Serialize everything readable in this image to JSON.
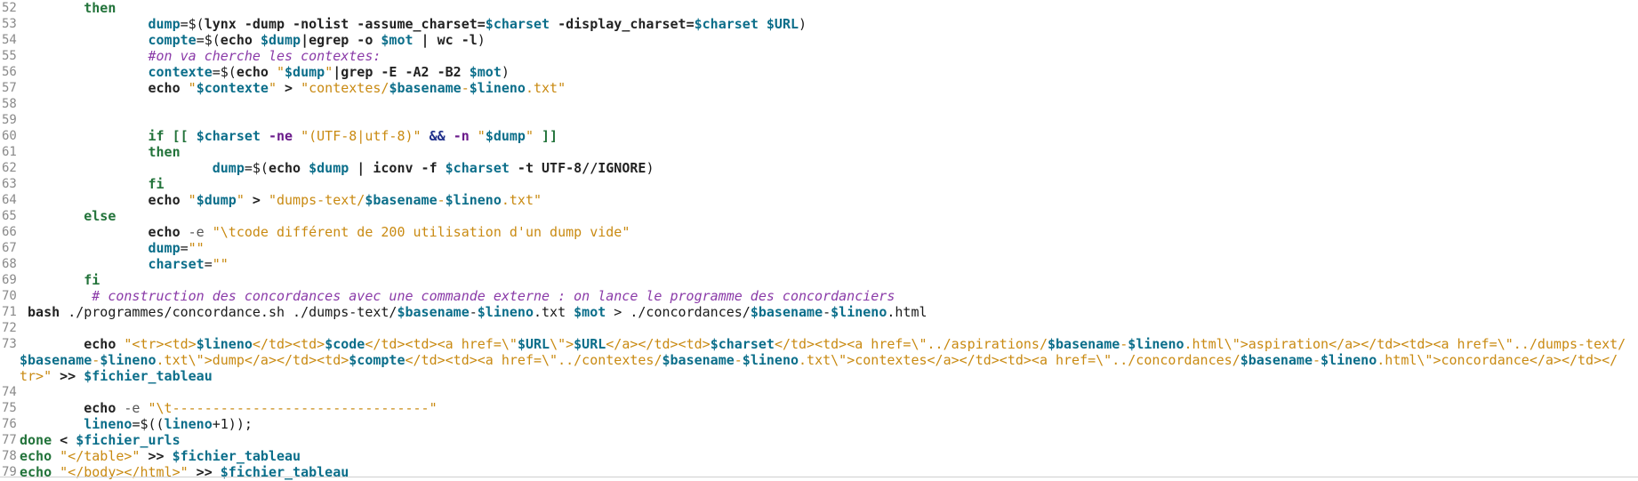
{
  "editor": {
    "lines": [
      {
        "n": "52",
        "tokens": [
          {
            "t": "        ",
            "c": "plain"
          },
          {
            "t": "then",
            "c": "kw"
          }
        ]
      },
      {
        "n": "53",
        "tokens": [
          {
            "t": "                ",
            "c": "plain"
          },
          {
            "t": "dump",
            "c": "var"
          },
          {
            "t": "=$(",
            "c": "plain"
          },
          {
            "t": "lynx -dump -nolist -assume_charset=",
            "c": "cmd"
          },
          {
            "t": "$charset",
            "c": "var"
          },
          {
            "t": " -display_charset=",
            "c": "cmd"
          },
          {
            "t": "$charset",
            "c": "var"
          },
          {
            "t": " ",
            "c": "plain"
          },
          {
            "t": "$URL",
            "c": "var"
          },
          {
            "t": ")",
            "c": "plain"
          }
        ]
      },
      {
        "n": "54",
        "tokens": [
          {
            "t": "                ",
            "c": "plain"
          },
          {
            "t": "compte",
            "c": "var"
          },
          {
            "t": "=$(",
            "c": "plain"
          },
          {
            "t": "echo ",
            "c": "cmd"
          },
          {
            "t": "$dump",
            "c": "var"
          },
          {
            "t": "|egrep -o ",
            "c": "cmd"
          },
          {
            "t": "$mot",
            "c": "var"
          },
          {
            "t": " | wc -l",
            "c": "cmd"
          },
          {
            "t": ")",
            "c": "plain"
          }
        ]
      },
      {
        "n": "55",
        "tokens": [
          {
            "t": "                ",
            "c": "plain"
          },
          {
            "t": "#on va cherche les contextes:",
            "c": "com"
          }
        ]
      },
      {
        "n": "56",
        "tokens": [
          {
            "t": "                ",
            "c": "plain"
          },
          {
            "t": "contexte",
            "c": "var"
          },
          {
            "t": "=$(",
            "c": "plain"
          },
          {
            "t": "echo ",
            "c": "cmd"
          },
          {
            "t": "\"",
            "c": "str"
          },
          {
            "t": "$dump",
            "c": "strvar"
          },
          {
            "t": "\"",
            "c": "str"
          },
          {
            "t": "|grep -E -A2 -B2 ",
            "c": "cmd"
          },
          {
            "t": "$mot",
            "c": "var"
          },
          {
            "t": ")",
            "c": "plain"
          }
        ]
      },
      {
        "n": "57",
        "tokens": [
          {
            "t": "                ",
            "c": "plain"
          },
          {
            "t": "echo ",
            "c": "cmd"
          },
          {
            "t": "\"",
            "c": "str"
          },
          {
            "t": "$contexte",
            "c": "strvar"
          },
          {
            "t": "\"",
            "c": "str"
          },
          {
            "t": " > ",
            "c": "cmd"
          },
          {
            "t": "\"contextes/",
            "c": "str"
          },
          {
            "t": "$basename",
            "c": "strvar"
          },
          {
            "t": "-",
            "c": "str"
          },
          {
            "t": "$lineno",
            "c": "strvar"
          },
          {
            "t": ".txt\"",
            "c": "str"
          }
        ]
      },
      {
        "n": "58",
        "tokens": [
          {
            "t": "",
            "c": "plain"
          }
        ]
      },
      {
        "n": "59",
        "tokens": [
          {
            "t": "",
            "c": "plain"
          }
        ]
      },
      {
        "n": "60",
        "tokens": [
          {
            "t": "                ",
            "c": "plain"
          },
          {
            "t": "if [[ ",
            "c": "kw"
          },
          {
            "t": "$charset",
            "c": "var"
          },
          {
            "t": " -ne ",
            "c": "test"
          },
          {
            "t": "\"(UTF-8|utf-8)\"",
            "c": "str"
          },
          {
            "t": " && ",
            "c": "op"
          },
          {
            "t": "-n ",
            "c": "test"
          },
          {
            "t": "\"",
            "c": "str"
          },
          {
            "t": "$dump",
            "c": "strvar"
          },
          {
            "t": "\"",
            "c": "str"
          },
          {
            "t": " ]]",
            "c": "kw"
          }
        ]
      },
      {
        "n": "61",
        "tokens": [
          {
            "t": "                ",
            "c": "plain"
          },
          {
            "t": "then",
            "c": "kw"
          }
        ]
      },
      {
        "n": "62",
        "tokens": [
          {
            "t": "                        ",
            "c": "plain"
          },
          {
            "t": "dump",
            "c": "var"
          },
          {
            "t": "=$(",
            "c": "plain"
          },
          {
            "t": "echo ",
            "c": "cmd"
          },
          {
            "t": "$dump",
            "c": "var"
          },
          {
            "t": " | iconv -f ",
            "c": "cmd"
          },
          {
            "t": "$charset",
            "c": "var"
          },
          {
            "t": " -t UTF-8//IGNORE",
            "c": "cmd"
          },
          {
            "t": ")",
            "c": "plain"
          }
        ]
      },
      {
        "n": "63",
        "tokens": [
          {
            "t": "                ",
            "c": "plain"
          },
          {
            "t": "fi",
            "c": "kw"
          }
        ]
      },
      {
        "n": "64",
        "tokens": [
          {
            "t": "                ",
            "c": "plain"
          },
          {
            "t": "echo ",
            "c": "cmd"
          },
          {
            "t": "\"",
            "c": "str"
          },
          {
            "t": "$dump",
            "c": "strvar"
          },
          {
            "t": "\"",
            "c": "str"
          },
          {
            "t": " > ",
            "c": "cmd"
          },
          {
            "t": "\"dumps-text/",
            "c": "str"
          },
          {
            "t": "$basename",
            "c": "strvar"
          },
          {
            "t": "-",
            "c": "str"
          },
          {
            "t": "$lineno",
            "c": "strvar"
          },
          {
            "t": ".txt\"",
            "c": "str"
          }
        ]
      },
      {
        "n": "65",
        "tokens": [
          {
            "t": "        ",
            "c": "plain"
          },
          {
            "t": "else",
            "c": "kw"
          }
        ]
      },
      {
        "n": "66",
        "tokens": [
          {
            "t": "                ",
            "c": "plain"
          },
          {
            "t": "echo ",
            "c": "cmd"
          },
          {
            "t": "-e ",
            "c": "dim"
          },
          {
            "t": "\"\\tcode différent de 200 utilisation d'un dump vide\"",
            "c": "str"
          }
        ]
      },
      {
        "n": "67",
        "tokens": [
          {
            "t": "                ",
            "c": "plain"
          },
          {
            "t": "dump",
            "c": "var"
          },
          {
            "t": "=",
            "c": "plain"
          },
          {
            "t": "\"\"",
            "c": "str"
          }
        ]
      },
      {
        "n": "68",
        "tokens": [
          {
            "t": "                ",
            "c": "plain"
          },
          {
            "t": "charset",
            "c": "var"
          },
          {
            "t": "=",
            "c": "plain"
          },
          {
            "t": "\"\"",
            "c": "str"
          }
        ]
      },
      {
        "n": "69",
        "tokens": [
          {
            "t": "        ",
            "c": "plain"
          },
          {
            "t": "fi",
            "c": "kw"
          }
        ]
      },
      {
        "n": "70",
        "tokens": [
          {
            "t": "         ",
            "c": "plain"
          },
          {
            "t": "# construction des concordances avec une commande externe : on lance le programme des concordanciers",
            "c": "com"
          }
        ]
      },
      {
        "n": "71",
        "tokens": [
          {
            "t": " ",
            "c": "plain"
          },
          {
            "t": "bash ",
            "c": "cmd"
          },
          {
            "t": "./programmes/concordance.sh ./dumps-text/",
            "c": "plain"
          },
          {
            "t": "$basename",
            "c": "var"
          },
          {
            "t": "-",
            "c": "plain"
          },
          {
            "t": "$lineno",
            "c": "var"
          },
          {
            "t": ".txt ",
            "c": "plain"
          },
          {
            "t": "$mot",
            "c": "var"
          },
          {
            "t": " > ./concordances/",
            "c": "plain"
          },
          {
            "t": "$basename",
            "c": "var"
          },
          {
            "t": "-",
            "c": "plain"
          },
          {
            "t": "$lineno",
            "c": "var"
          },
          {
            "t": ".html",
            "c": "plain"
          }
        ]
      },
      {
        "n": "72",
        "tokens": [
          {
            "t": "",
            "c": "plain"
          }
        ]
      },
      {
        "n": "73",
        "tokens": [
          {
            "t": "        ",
            "c": "plain"
          },
          {
            "t": "echo ",
            "c": "cmd"
          },
          {
            "t": "\"<tr><td>",
            "c": "str"
          },
          {
            "t": "$lineno",
            "c": "strvar"
          },
          {
            "t": "</td><td>",
            "c": "str"
          },
          {
            "t": "$code",
            "c": "strvar"
          },
          {
            "t": "</td><td><a href=\\\"",
            "c": "str"
          },
          {
            "t": "$URL",
            "c": "strvar"
          },
          {
            "t": "\\\">",
            "c": "str"
          },
          {
            "t": "$URL",
            "c": "strvar"
          },
          {
            "t": "</a></td><td>",
            "c": "str"
          },
          {
            "t": "$charset",
            "c": "strvar"
          },
          {
            "t": "</td><td><a href=\\\"../aspirations/",
            "c": "str"
          },
          {
            "t": "$basename",
            "c": "strvar"
          },
          {
            "t": "-",
            "c": "str"
          },
          {
            "t": "$lineno",
            "c": "strvar"
          },
          {
            "t": ".html\\\">aspiration</a></td><td><a href=\\\"../dumps-text/",
            "c": "str"
          }
        ]
      },
      {
        "n": "",
        "tokens": [
          {
            "t": "$basename",
            "c": "strvar"
          },
          {
            "t": "-",
            "c": "str"
          },
          {
            "t": "$lineno",
            "c": "strvar"
          },
          {
            "t": ".txt\\\">dump</a></td><td>",
            "c": "str"
          },
          {
            "t": "$compte",
            "c": "strvar"
          },
          {
            "t": "</td><td><a href=\\\"../contextes/",
            "c": "str"
          },
          {
            "t": "$basename",
            "c": "strvar"
          },
          {
            "t": "-",
            "c": "str"
          },
          {
            "t": "$lineno",
            "c": "strvar"
          },
          {
            "t": ".txt\\\">contextes</a></td><td><a href=\\\"../concordances/",
            "c": "str"
          },
          {
            "t": "$basename",
            "c": "strvar"
          },
          {
            "t": "-",
            "c": "str"
          },
          {
            "t": "$lineno",
            "c": "strvar"
          },
          {
            "t": ".html\\\">concordance</a></td></",
            "c": "str"
          }
        ]
      },
      {
        "n": "",
        "tokens": [
          {
            "t": "tr>\"",
            "c": "str"
          },
          {
            "t": " >> ",
            "c": "cmd"
          },
          {
            "t": "$fichier_tableau",
            "c": "var"
          }
        ]
      },
      {
        "n": "74",
        "tokens": [
          {
            "t": "",
            "c": "plain"
          }
        ]
      },
      {
        "n": "75",
        "tokens": [
          {
            "t": "        ",
            "c": "plain"
          },
          {
            "t": "echo ",
            "c": "cmd"
          },
          {
            "t": "-e ",
            "c": "dim"
          },
          {
            "t": "\"\\t--------------------------------\"",
            "c": "str"
          }
        ]
      },
      {
        "n": "76",
        "tokens": [
          {
            "t": "        ",
            "c": "plain"
          },
          {
            "t": "lineno",
            "c": "var"
          },
          {
            "t": "=$((",
            "c": "plain"
          },
          {
            "t": "lineno",
            "c": "var"
          },
          {
            "t": "+1));",
            "c": "plain"
          }
        ]
      },
      {
        "n": "77",
        "tokens": [
          {
            "t": "done",
            "c": "kw"
          },
          {
            "t": " < ",
            "c": "cmd"
          },
          {
            "t": "$fichier_urls",
            "c": "var"
          }
        ]
      },
      {
        "n": "78",
        "tokens": [
          {
            "t": "echo ",
            "c": "kw"
          },
          {
            "t": "\"</table>\"",
            "c": "str"
          },
          {
            "t": " >> ",
            "c": "cmd"
          },
          {
            "t": "$fichier_tableau",
            "c": "var"
          }
        ]
      },
      {
        "n": "79",
        "tokens": [
          {
            "t": "echo ",
            "c": "kw"
          },
          {
            "t": "\"</body></html>\"",
            "c": "str"
          },
          {
            "t": " >> ",
            "c": "cmd"
          },
          {
            "t": "$fichier_tableau",
            "c": "var"
          }
        ]
      }
    ]
  }
}
